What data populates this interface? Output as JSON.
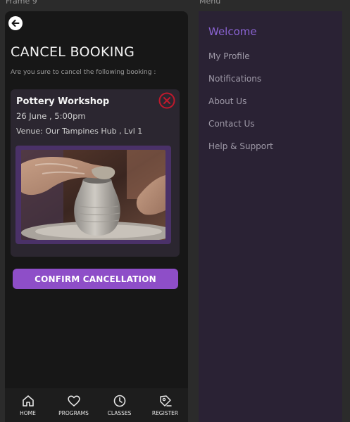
{
  "frames": {
    "left_label": "Frame 9",
    "right_label": "Menu"
  },
  "screen": {
    "title": "CANCEL BOOKING",
    "subtitle": "Are you sure to cancel the following booking :",
    "card": {
      "title": "Pottery Workshop",
      "date": "26 June , 5:00pm",
      "venue": "Venue: Our Tampines Hub , Lvl 1",
      "image_subject": "pottery-wheel-photo"
    },
    "confirm_label": "CONFIRM CANCELLATION"
  },
  "bottom_nav": [
    {
      "label": "HOME",
      "icon": "home-icon"
    },
    {
      "label": "PROGRAMS",
      "icon": "heart-icon"
    },
    {
      "label": "CLASSES",
      "icon": "clock-icon"
    },
    {
      "label": "REGISTER",
      "icon": "pen-icon"
    }
  ],
  "menu": {
    "welcome": "Welcome",
    "items": [
      "My Profile",
      "Notifications",
      "About Us",
      "Contact Us",
      "Help & Support"
    ]
  },
  "colors": {
    "accent": "#8e4ec8",
    "menu_accent": "#8a63d2",
    "close_red": "#c0192c"
  }
}
